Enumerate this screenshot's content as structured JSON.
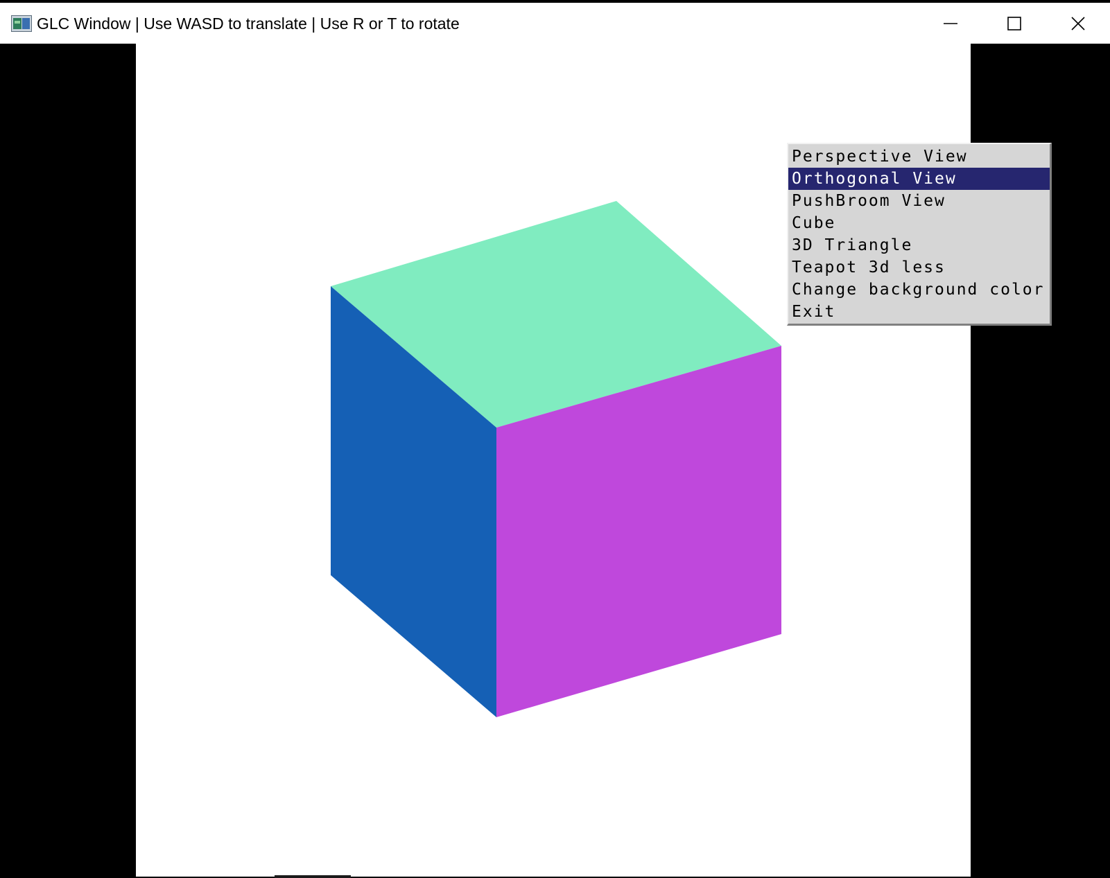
{
  "window": {
    "title": "GLC Window | Use WASD to translate | Use R or T to rotate",
    "controls": {
      "minimize_icon": "minimize-icon",
      "maximize_icon": "maximize-icon",
      "close_icon": "close-icon"
    }
  },
  "viewport": {
    "background": "#ffffff",
    "scene": {
      "object": "cube",
      "faces": [
        {
          "name": "top",
          "color": "#80ecc0"
        },
        {
          "name": "left",
          "color": "#1560b5"
        },
        {
          "name": "right",
          "color": "#bf48dc"
        }
      ]
    }
  },
  "context_menu": {
    "selected_index": 1,
    "items": [
      {
        "label": "Perspective View"
      },
      {
        "label": "Orthogonal View"
      },
      {
        "label": "PushBroom View"
      },
      {
        "label": "Cube"
      },
      {
        "label": "3D Triangle"
      },
      {
        "label": "Teapot 3d less"
      },
      {
        "label": "Change background color"
      },
      {
        "label": "Exit"
      }
    ],
    "highlight_color": "#26266f"
  }
}
